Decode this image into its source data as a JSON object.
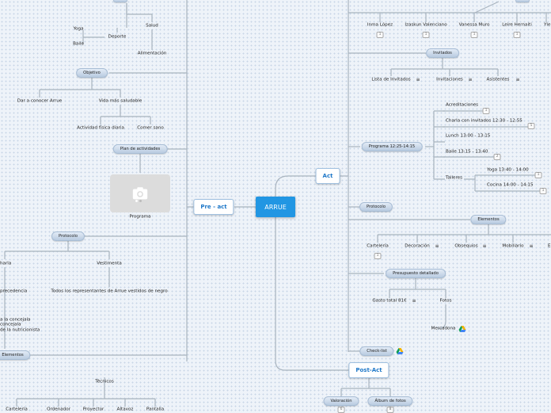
{
  "root": {
    "label": "ARRUE"
  },
  "main_topics": {
    "pre_act": "Pre - act",
    "act": "Act",
    "post_act": "Post-Act"
  },
  "pre_act": {
    "salud": "Salud",
    "yoga": "Yoga",
    "deporte": "Deporte",
    "baile": "Baile",
    "alimentacion": "Alimentación",
    "objetivo": "Objetivo",
    "dar_a_conocer": "Dar a conocer Arrue",
    "vida_saludable": "Vida más saludable",
    "actividad_fisica": "Actividad física diaria",
    "comer_sano": "Comer sano",
    "plan_actividades": "Plan de actividades",
    "programa": "Programa",
    "protocolo": "Protocolo",
    "charla": "harla",
    "vestimenta": "Vestimenta",
    "precedencia": "precedencia",
    "vestimenta_desc": "Todos los representantes de Arrue vestidos de negro",
    "concejala_lines": [
      "a la concejala",
      "concejala",
      "de la nutricionista"
    ],
    "elementos": "Elementos",
    "tecnicos": "Técnicos",
    "tecnicos_items": [
      "Cartelería",
      "Ordenador",
      "Proyector",
      "Altavoz",
      "Pantalla"
    ]
  },
  "act": {
    "invitados_people": [
      "Inma López",
      "Izaskun Valenciano",
      "Vanessa Muro",
      "Leire Hernaiti",
      "Yle"
    ],
    "invitados": "Invitados",
    "invitados_items": [
      "Lista de Invitados",
      "Invitaciones",
      "Asistentes"
    ],
    "programa": "Programa 12:25-14:15",
    "programa_items": {
      "acreditaciones": "Acreditaciones",
      "charla": "Charla con invitados 12:30 - 12:55",
      "lunch": "Lunch 13:00 - 13:15",
      "baile": "Baile 13:15 - 13:40",
      "talleres": "Talleres",
      "yoga": "Yoga 13:40 - 14:00",
      "cocina": "Cocina 14:00 - 14:15"
    },
    "counts": {
      "acreditaciones": "1",
      "charla": "5",
      "baile": "2",
      "yoga": "1",
      "cocina": "1",
      "inma": "1",
      "izaskun": "1",
      "vanessa": "1",
      "leire": "1",
      "carteleria": "1",
      "valoracion": "6",
      "album": "8"
    },
    "protocolo": "Protocolo",
    "elementos": "Elementos",
    "elementos_items": [
      "Cartelería",
      "Decoración",
      "Obsequios",
      "Mobiliario",
      "E"
    ],
    "presupuesto": "Presupuesto detallado",
    "gasto_total": "Gasto total 81€",
    "fotos": "Fotos",
    "mercadona": "Mercadona",
    "checklist": "Check-list"
  },
  "post_act": {
    "valoracion": "Valoración",
    "album": "Álbum de fotos"
  },
  "colors": {
    "root": "#2196e3",
    "topic_text": "#1f78c8",
    "line": "#a9b4bf"
  }
}
